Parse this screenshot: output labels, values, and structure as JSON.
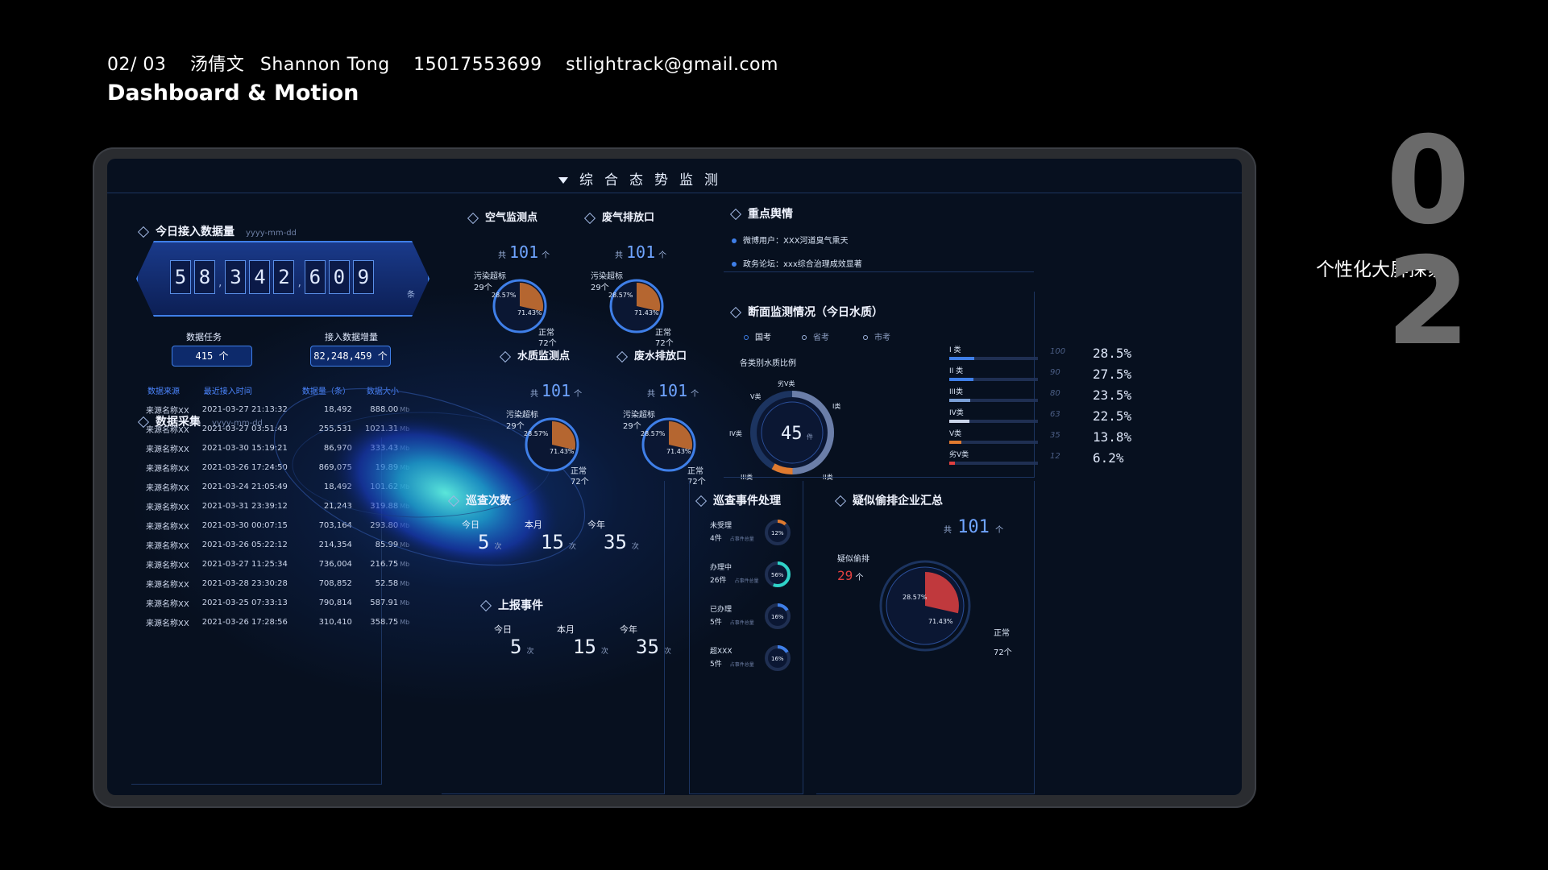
{
  "header": {
    "page_no": "02/ 03",
    "author_cn": "汤倩文",
    "author_en": "Shannon Tong",
    "phone": "15017553699",
    "email": "stlightrack@gmail.com",
    "title": "Dashboard & Motion",
    "big_digit_1": "0",
    "big_digit_2": "2",
    "side_caption": "个性化大屏探索"
  },
  "dashboard": {
    "title": "综合态势监测",
    "today_data": {
      "title": "今日接入数据量",
      "date_placeholder": "yyyy-mm-dd",
      "digits": [
        "5",
        "8",
        "3",
        "4",
        "2",
        "6",
        "0",
        "9"
      ],
      "unit": "条",
      "task_label": "数据任务",
      "task_value": "415 个",
      "increase_label": "接入数据增量",
      "increase_value": "82,248,459 个"
    },
    "collection": {
      "title": "数据采集",
      "date_placeholder": "yyyy-mm-dd",
      "columns": [
        "数据来源",
        "最近接入时间",
        "数据量（条）",
        "数据大小"
      ],
      "unit": "Mb",
      "rows": [
        [
          "来源名称XX",
          "2021-03-27 21:13:32",
          "18,492",
          "888.00"
        ],
        [
          "来源名称XX",
          "2021-03-27 03:51:43",
          "255,531",
          "1021.31"
        ],
        [
          "来源名称XX",
          "2021-03-30 15:19:21",
          "86,970",
          "333.43"
        ],
        [
          "来源名称XX",
          "2021-03-26 17:24:50",
          "869,075",
          "19.89"
        ],
        [
          "来源名称XX",
          "2021-03-24 21:05:49",
          "18,492",
          "101.62"
        ],
        [
          "来源名称XX",
          "2021-03-31 23:39:12",
          "21,243",
          "319.88"
        ],
        [
          "来源名称XX",
          "2021-03-30 00:07:15",
          "703,164",
          "293.80"
        ],
        [
          "来源名称XX",
          "2021-03-26 05:22:12",
          "214,354",
          "85.99"
        ],
        [
          "来源名称XX",
          "2021-03-27 11:25:34",
          "736,004",
          "216.75"
        ],
        [
          "来源名称XX",
          "2021-03-28 23:30:28",
          "708,852",
          "52.58"
        ],
        [
          "来源名称XX",
          "2021-03-25 07:33:13",
          "790,814",
          "587.91"
        ],
        [
          "来源名称XX",
          "2021-03-26 17:28:56",
          "310,410",
          "358.75"
        ]
      ]
    },
    "monitors": [
      {
        "title": "空气监测点",
        "total_prefix": "共",
        "total": "101",
        "total_unit": "个",
        "polluted_label": "污染超标",
        "polluted_count": "29个",
        "polluted_pct": "28.57%",
        "normal_pct": "71.43%",
        "normal_label": "正常",
        "normal_count": "72个",
        "fraction": 0.2857
      },
      {
        "title": "废气排放口",
        "total_prefix": "共",
        "total": "101",
        "total_unit": "个",
        "polluted_label": "污染超标",
        "polluted_count": "29个",
        "polluted_pct": "28.57%",
        "normal_pct": "71.43%",
        "normal_label": "正常",
        "normal_count": "72个",
        "fraction": 0.2857
      },
      {
        "title": "水质监测点",
        "total_prefix": "共",
        "total": "101",
        "total_unit": "个",
        "polluted_label": "污染超标",
        "polluted_count": "29个",
        "polluted_pct": "28.57%",
        "normal_pct": "71.43%",
        "normal_label": "正常",
        "normal_count": "72个",
        "fraction": 0.2857
      },
      {
        "title": "废水排放口",
        "total_prefix": "共",
        "total": "101",
        "total_unit": "个",
        "polluted_label": "污染超标",
        "polluted_count": "29个",
        "polluted_pct": "28.57%",
        "normal_pct": "71.43%",
        "normal_label": "正常",
        "normal_count": "72个",
        "fraction": 0.2857
      }
    ],
    "opinion": {
      "title": "重点舆情",
      "items": [
        "微博用户：XXX河道臭气熏天",
        "政务论坛：xxx综合治理成效显著"
      ]
    },
    "section": {
      "title": "断面监测情况（今日水质）",
      "tabs": [
        "国考",
        "省考",
        "市考"
      ],
      "ratio_title": "各类别水质比例",
      "gauge_value": "45",
      "gauge_unit": "件",
      "gauge_labels": [
        "劣V类",
        "V类",
        "IV类",
        "III类",
        "II类",
        "I类"
      ],
      "classes": [
        {
          "name": "I 类",
          "max": "100",
          "pct": "28.5%",
          "fraction": 0.285,
          "color": "#3f7fe8"
        },
        {
          "name": "II 类",
          "max": "90",
          "pct": "27.5%",
          "fraction": 0.275,
          "color": "#3f7fe8"
        },
        {
          "name": "III类",
          "max": "80",
          "pct": "23.5%",
          "fraction": 0.235,
          "color": "#7a9fd6"
        },
        {
          "name": "IV类",
          "max": "63",
          "pct": "22.5%",
          "fraction": 0.225,
          "color": "#c9d4e8"
        },
        {
          "name": "V类",
          "max": "35",
          "pct": "13.8%",
          "fraction": 0.138,
          "color": "#e07a2f"
        },
        {
          "name": "劣V类",
          "max": "12",
          "pct": "6.2%",
          "fraction": 0.062,
          "color": "#e04040"
        }
      ]
    },
    "patrol": {
      "title": "巡查次数",
      "labels": [
        "今日",
        "本月",
        "今年"
      ],
      "values": [
        "5",
        "15",
        "35"
      ],
      "unit": "次"
    },
    "report": {
      "title": "上报事件",
      "labels": [
        "今日",
        "本月",
        "今年"
      ],
      "values": [
        "5",
        "15",
        "35"
      ],
      "unit": "次"
    },
    "events": {
      "title": "巡查事件处理",
      "note": "占事件总量",
      "items": [
        {
          "label": "未受理",
          "count": "4件",
          "pct": "12%",
          "fraction": 0.12,
          "color": "#e07a2f"
        },
        {
          "label": "办理中",
          "count": "26件",
          "pct": "56%",
          "fraction": 0.56,
          "color": "#2fd3c8"
        },
        {
          "label": "已办理",
          "count": "5件",
          "pct": "16%",
          "fraction": 0.16,
          "color": "#3f7fe8"
        },
        {
          "label": "超XXX",
          "count": "5件",
          "pct": "16%",
          "fraction": 0.16,
          "color": "#3f7fe8"
        }
      ]
    },
    "suspect": {
      "title": "疑似偷排企业汇总",
      "total_prefix": "共",
      "total": "101",
      "total_unit": "个",
      "suspect_label": "疑似偷排",
      "suspect_count": "29",
      "suspect_unit": "个",
      "suspect_pct": "28.57%",
      "normal_pct": "71.43%",
      "normal_label": "正常",
      "normal_count": "72个",
      "fraction": 0.2857
    }
  },
  "colors": {
    "accent": "#3f7fe8",
    "pollution": "#e07a2f",
    "alert": "#e04040",
    "background": "#07101f"
  }
}
